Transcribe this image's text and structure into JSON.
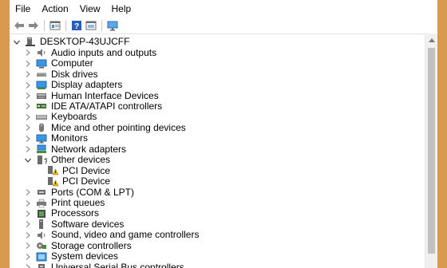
{
  "menu": [
    "File",
    "Action",
    "View",
    "Help"
  ],
  "toolbar": {
    "icons": [
      "back-arrow-icon",
      "forward-arrow-icon",
      "properties-icon",
      "help-icon",
      "view-icon",
      "monitor-icon"
    ]
  },
  "tree": {
    "root": "DESKTOP-43UJCFF",
    "categories": [
      {
        "label": "Audio inputs and outputs",
        "icon": "speaker-icon"
      },
      {
        "label": "Computer",
        "icon": "computer-icon"
      },
      {
        "label": "Disk drives",
        "icon": "disk-drive-icon"
      },
      {
        "label": "Display adapters",
        "icon": "display-adapter-icon"
      },
      {
        "label": "Human Interface Devices",
        "icon": "hid-icon"
      },
      {
        "label": "IDE ATA/ATAPI controllers",
        "icon": "ide-controller-icon"
      },
      {
        "label": "Keyboards",
        "icon": "keyboard-icon"
      },
      {
        "label": "Mice and other pointing devices",
        "icon": "mouse-icon"
      },
      {
        "label": "Monitors",
        "icon": "monitor-icon"
      },
      {
        "label": "Network adapters",
        "icon": "network-adapter-icon"
      },
      {
        "label": "Other devices",
        "icon": "unknown-device-icon",
        "expanded": true,
        "children": [
          "PCI Device",
          "PCI Device"
        ]
      },
      {
        "label": "Ports (COM & LPT)",
        "icon": "port-icon"
      },
      {
        "label": "Print queues",
        "icon": "printer-icon"
      },
      {
        "label": "Processors",
        "icon": "processor-icon"
      },
      {
        "label": "Software devices",
        "icon": "software-device-icon"
      },
      {
        "label": "Sound, video and game controllers",
        "icon": "speaker-icon"
      },
      {
        "label": "Storage controllers",
        "icon": "storage-controller-icon"
      },
      {
        "label": "System devices",
        "icon": "system-device-icon"
      },
      {
        "label": "Universal Serial Bus controllers",
        "icon": "usb-icon"
      }
    ]
  },
  "colors": {
    "background": "#d99a4e",
    "window": "#ffffff",
    "icon_blue": "#2f7fd6",
    "warning": "#f0b400"
  }
}
